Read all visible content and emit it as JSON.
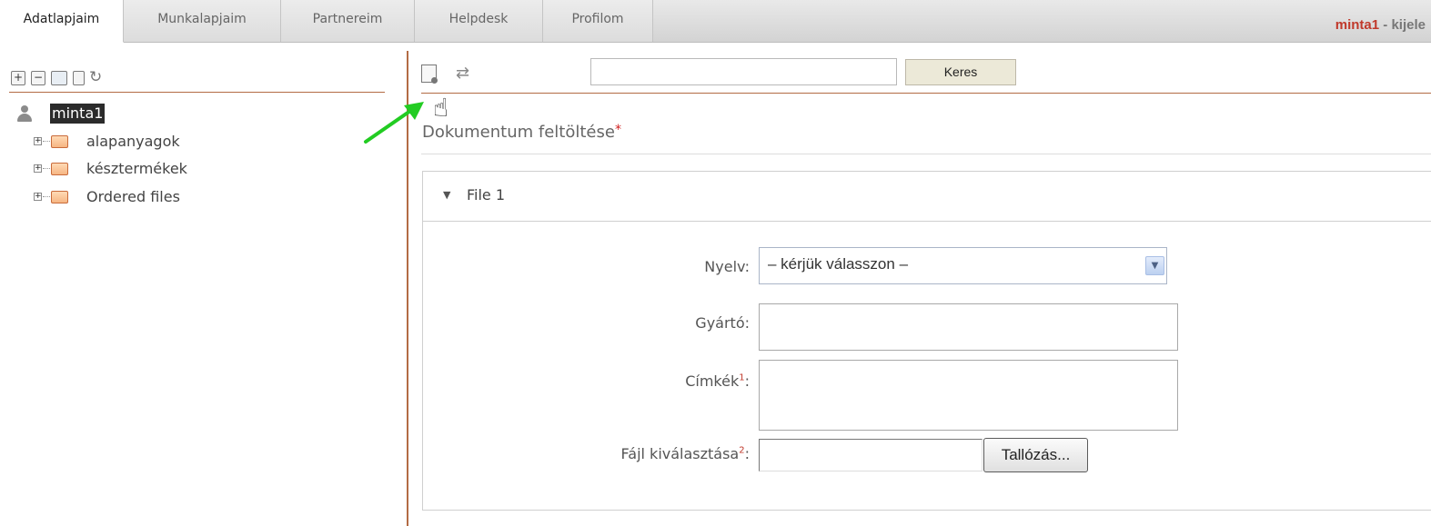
{
  "tabs": [
    {
      "label": "Adatlapjaim",
      "active": true
    },
    {
      "label": "Munkalapjaim",
      "active": false
    },
    {
      "label": "Partnereim",
      "active": false
    },
    {
      "label": "Helpdesk",
      "active": false
    },
    {
      "label": "Profilom",
      "active": false
    }
  ],
  "header": {
    "username": "minta1",
    "separator": " - ",
    "logout": "kijele"
  },
  "tree": {
    "toolbar_icons": [
      "expand-all-icon",
      "collapse-all-icon",
      "new-folder-icon",
      "new-document-icon",
      "refresh-icon"
    ],
    "root_label": "minta1",
    "items": [
      {
        "label": "alapanyagok"
      },
      {
        "label": "késztermékek"
      },
      {
        "label": "Ordered files"
      }
    ]
  },
  "right_toolbar": {
    "icons": [
      "upload-document-icon",
      "refresh-icon"
    ],
    "search_placeholder": "",
    "search_button": "Keres"
  },
  "upload": {
    "title": "Dokumentum feltöltése",
    "title_required": "*",
    "fieldset_title": "File 1",
    "language_label": "Nyelv:",
    "language_selected": "– kérjük válasszon –",
    "manufacturer_label": "Gyártó:",
    "tags_label": "Címkék",
    "tags_sup": "1",
    "tags_colon": ":",
    "file_label": "Fájl kiválasztása",
    "file_sup": "2",
    "file_colon": ":",
    "browse_button": "Tallózás..."
  },
  "colors": {
    "accent_line": "#b36b44",
    "username": "#c0392b",
    "arrow": "#22cc22"
  }
}
